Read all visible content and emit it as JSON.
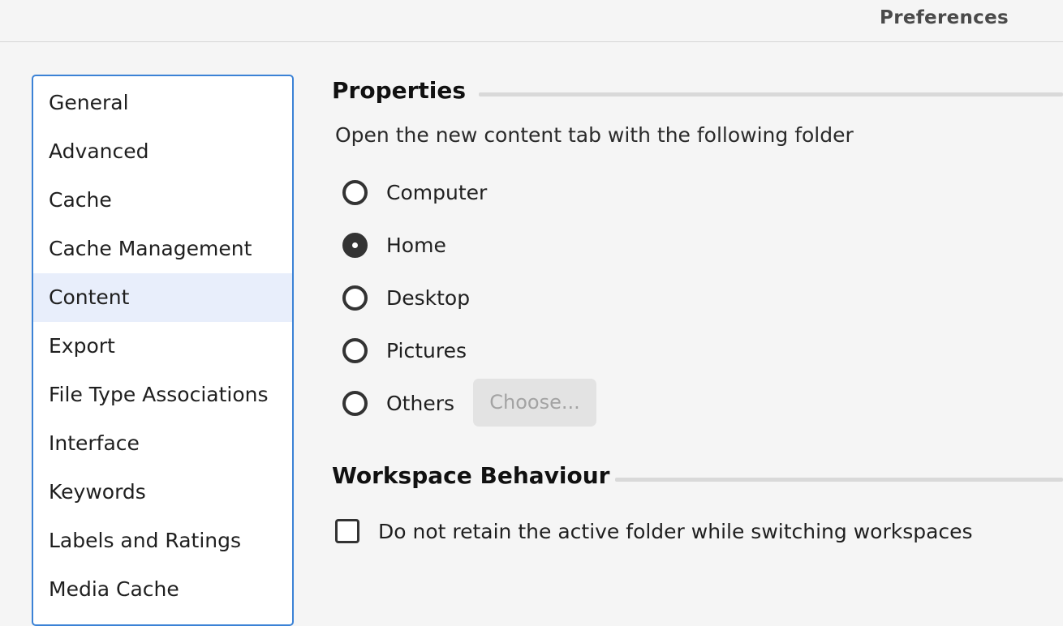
{
  "window": {
    "title": "Preferences"
  },
  "sidebar": {
    "items": [
      {
        "label": "General",
        "selected": false
      },
      {
        "label": "Advanced",
        "selected": false
      },
      {
        "label": "Cache",
        "selected": false
      },
      {
        "label": "Cache Management",
        "selected": false
      },
      {
        "label": "Content",
        "selected": true
      },
      {
        "label": "Export",
        "selected": false
      },
      {
        "label": "File Type Associations",
        "selected": false
      },
      {
        "label": "Interface",
        "selected": false
      },
      {
        "label": "Keywords",
        "selected": false
      },
      {
        "label": "Labels and Ratings",
        "selected": false
      },
      {
        "label": "Media Cache",
        "selected": false
      }
    ]
  },
  "properties": {
    "heading": "Properties",
    "description": "Open the new content tab with the following folder",
    "options": [
      {
        "label": "Computer",
        "checked": false
      },
      {
        "label": "Home",
        "checked": true
      },
      {
        "label": "Desktop",
        "checked": false
      },
      {
        "label": "Pictures",
        "checked": false
      },
      {
        "label": "Others",
        "checked": false
      }
    ],
    "choose_button": "Choose..."
  },
  "workspace": {
    "heading": "Workspace Behaviour",
    "checkbox_label": "Do not retain the active folder while switching workspaces",
    "checkbox_checked": false
  },
  "colors": {
    "accent": "#3b82d6",
    "selected_background": "#e8eefb"
  }
}
